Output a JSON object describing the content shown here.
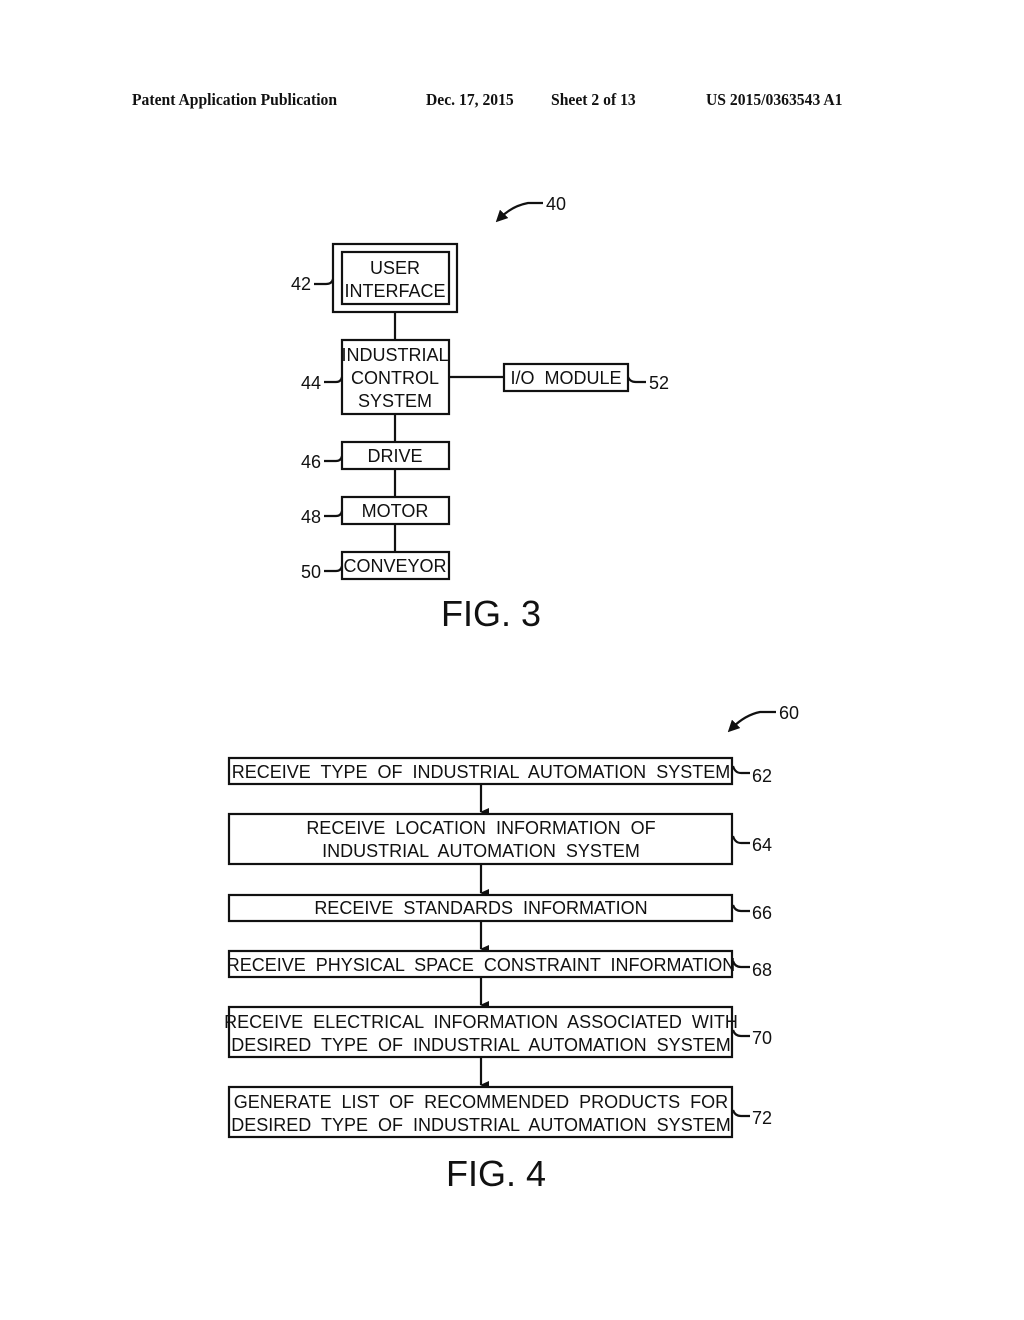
{
  "header": {
    "publication": "Patent Application Publication",
    "date": "Dec. 17, 2015",
    "sheet": "Sheet 2 of 13",
    "number": "US 2015/0363543 A1"
  },
  "fig3": {
    "caption": "FIG. 3",
    "ref": "40",
    "blocks": [
      {
        "ref": "42",
        "lines": [
          "USER",
          "INTERFACE"
        ]
      },
      {
        "ref": "44",
        "lines": [
          "INDUSTRIAL",
          "CONTROL",
          "SYSTEM"
        ]
      },
      {
        "ref": "46",
        "lines": [
          "DRIVE"
        ]
      },
      {
        "ref": "48",
        "lines": [
          "MOTOR"
        ]
      },
      {
        "ref": "50",
        "lines": [
          "CONVEYOR"
        ]
      },
      {
        "ref": "52",
        "lines": [
          "I/O  MODULE"
        ]
      }
    ]
  },
  "fig4": {
    "caption": "FIG. 4",
    "ref": "60",
    "steps": [
      {
        "ref": "62",
        "lines": [
          "RECEIVE  TYPE  OF  INDUSTRIAL  AUTOMATION  SYSTEM"
        ]
      },
      {
        "ref": "64",
        "lines": [
          "RECEIVE  LOCATION  INFORMATION  OF",
          "INDUSTRIAL  AUTOMATION  SYSTEM"
        ]
      },
      {
        "ref": "66",
        "lines": [
          "RECEIVE  STANDARDS  INFORMATION"
        ]
      },
      {
        "ref": "68",
        "lines": [
          "RECEIVE  PHYSICAL  SPACE  CONSTRAINT  INFORMATION"
        ]
      },
      {
        "ref": "70",
        "lines": [
          "RECEIVE  ELECTRICAL  INFORMATION  ASSOCIATED  WITH",
          "DESIRED  TYPE  OF  INDUSTRIAL  AUTOMATION  SYSTEM"
        ]
      },
      {
        "ref": "72",
        "lines": [
          "GENERATE  LIST  OF  RECOMMENDED  PRODUCTS  FOR",
          "DESIRED  TYPE  OF  INDUSTRIAL  AUTOMATION  SYSTEM"
        ]
      }
    ]
  }
}
